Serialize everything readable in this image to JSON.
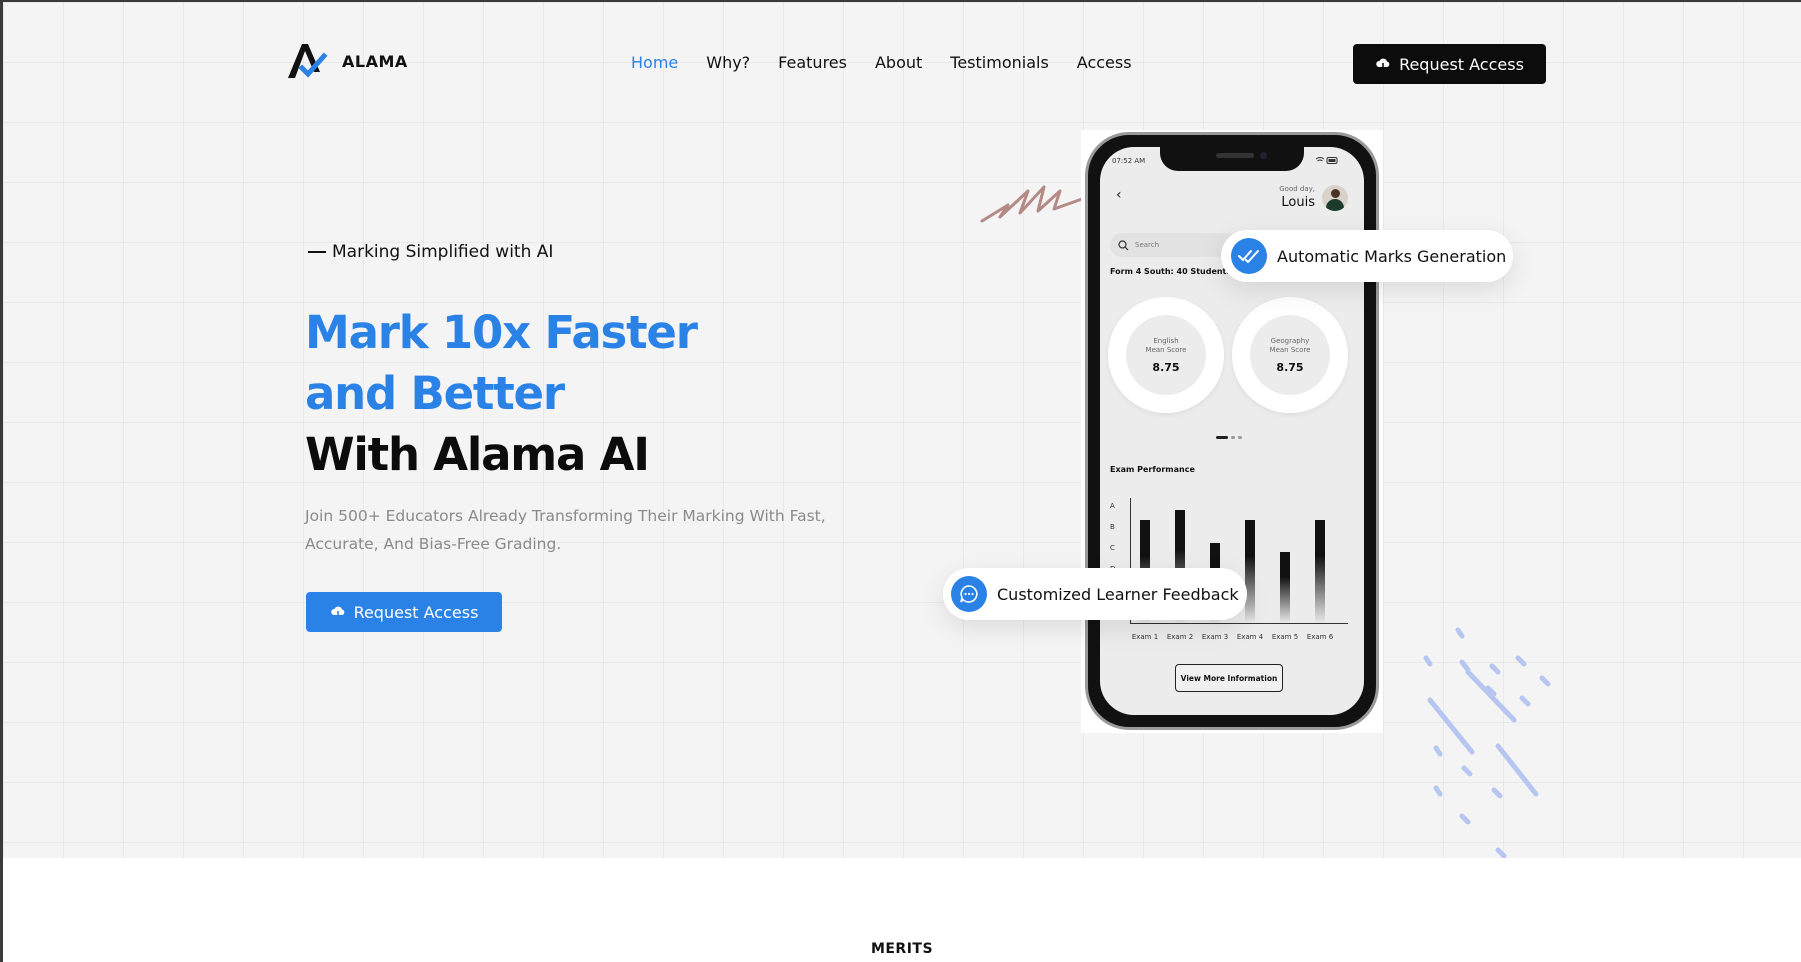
{
  "brand": {
    "name": "ALAMA"
  },
  "nav": {
    "items": [
      {
        "label": "Home",
        "active": true
      },
      {
        "label": "Why?"
      },
      {
        "label": "Features"
      },
      {
        "label": "About"
      },
      {
        "label": "Testimonials"
      },
      {
        "label": "Access"
      }
    ],
    "cta_label": "Request Access"
  },
  "hero": {
    "eyebrow": "Marking Simplified with AI",
    "headline_line1": "Mark 10x Faster",
    "headline_line2": "and Better",
    "headline_line3": "With Alama AI",
    "subtitle": "Join 500+ Educators Already Transforming Their Marking With Fast, Accurate, And Bias-Free Grading.",
    "cta_label": "Request Access"
  },
  "phone": {
    "time": "07:52 AM",
    "greeting": "Good day,",
    "user_name": "Louis",
    "search_placeholder": "Search",
    "class_info": "Form 4 South: 40 Students",
    "scores": [
      {
        "label_line1": "English",
        "label_line2": "Mean Score",
        "value": "8.75"
      },
      {
        "label_line1": "Geography",
        "label_line2": "Mean Score",
        "value": "8.75"
      }
    ],
    "performance_title": "Exam Performance",
    "more_label": "View More Information"
  },
  "chart_data": {
    "type": "bar",
    "title": "Exam Performance",
    "categories": [
      "Exam 1",
      "Exam 2",
      "Exam 3",
      "Exam 4",
      "Exam 5",
      "Exam 6"
    ],
    "y_tick_labels": [
      "A",
      "B",
      "C",
      "D"
    ],
    "values": [
      0.82,
      0.9,
      0.64,
      0.82,
      0.57,
      0.82
    ],
    "value_note": "bar height as fraction of axis height (grades A-D, no numeric scale printed)"
  },
  "badges": {
    "auto_marks": "Automatic Marks Generation",
    "feedback": "Customized Learner Feedback"
  },
  "colors": {
    "accent": "#2b82e6",
    "dark": "#0c0c0c",
    "muted": "#8a8a8a",
    "background": "#f4f4f4"
  },
  "section": {
    "next_heading": "MERITS"
  }
}
